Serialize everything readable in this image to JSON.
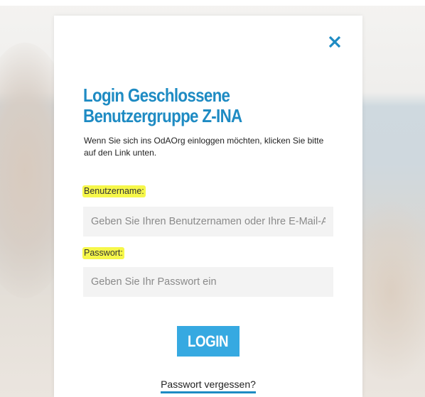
{
  "modal": {
    "close_icon": "close-icon",
    "title": "Login Geschlossene Benutzergruppe Z-INA",
    "intro": "Wenn Sie sich ins OdAOrg einloggen möchten, klicken Sie bitte auf den Link unten.",
    "username": {
      "label": "Benutzername:",
      "value": "",
      "placeholder": "Geben Sie Ihren Benutzernamen oder Ihre E-Mail-Adresse ein"
    },
    "password": {
      "label": "Passwort:",
      "value": "",
      "placeholder": "Geben Sie Ihr Passwort ein"
    },
    "login_label": "LOGIN",
    "forgot_label": "Passwort vergessen?"
  },
  "colors": {
    "accent": "#1e8bc3",
    "button": "#36a9e1",
    "highlight": "#f6f74a",
    "input_bg": "#f3f3f3"
  }
}
